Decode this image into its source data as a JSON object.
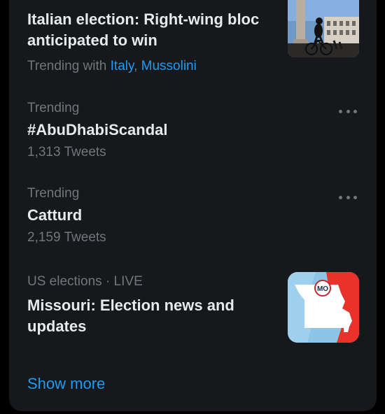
{
  "trends": [
    {
      "headline_line1": "Italian election: Right-wing bloc",
      "headline_line2": "anticipated to win",
      "context_prefix": "Trending with",
      "context_links": [
        "Italy",
        "Mussolini"
      ],
      "thumbnail_icon": "cyclist-plaza-photo"
    },
    {
      "context": "Trending",
      "name": "#AbuDhabiScandal",
      "tweet_count": "1,313 Tweets",
      "menu_icon": "more-dots-icon"
    },
    {
      "context": "Trending",
      "name": "Catturd",
      "tweet_count": "2,159 Tweets",
      "menu_icon": "more-dots-icon"
    },
    {
      "context": "US elections · LIVE",
      "headline_line1": "Missouri: Election news and",
      "headline_line2": "updates",
      "thumbnail_icon": "missouri-map-image",
      "map_badge": "MO"
    }
  ],
  "show_more_label": "Show more",
  "colors": {
    "panel_background": "#16181c",
    "primary_text": "#e7e9ea",
    "secondary_text": "#71767b",
    "accent": "#1d9bf0",
    "map_red": "#e8322a",
    "map_blue": "#8cc5e8"
  }
}
